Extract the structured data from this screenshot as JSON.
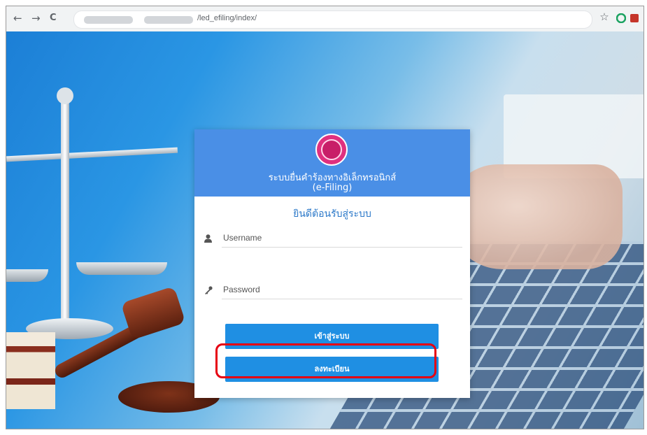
{
  "browser": {
    "back_glyph": "←",
    "forward_glyph": "→",
    "reload_glyph": "C",
    "url": "/led_efiling/index/",
    "icons": [
      "star-icon",
      "refresh-extension-icon",
      "pdf-extension-icon",
      "record-extension-icon",
      "profile-avatar"
    ]
  },
  "card": {
    "title_line1": "ระบบยื่นคำร้องทางอิเล็กทรอนิกส์",
    "title_line2": "(e-Filing)",
    "welcome": "ยินดีต้อนรับสู่ระบบ",
    "username_placeholder": "Username",
    "password_placeholder": "Password",
    "login_label": "เข้าสู่ระบบ",
    "register_label": "ลงทะเบียน"
  },
  "colors": {
    "header_blue": "#4a8fe6",
    "button_blue": "#1f8fe3",
    "welcome_text": "#2c79c9",
    "highlight_red": "#e60012",
    "seal_pink": "#e0307f"
  }
}
